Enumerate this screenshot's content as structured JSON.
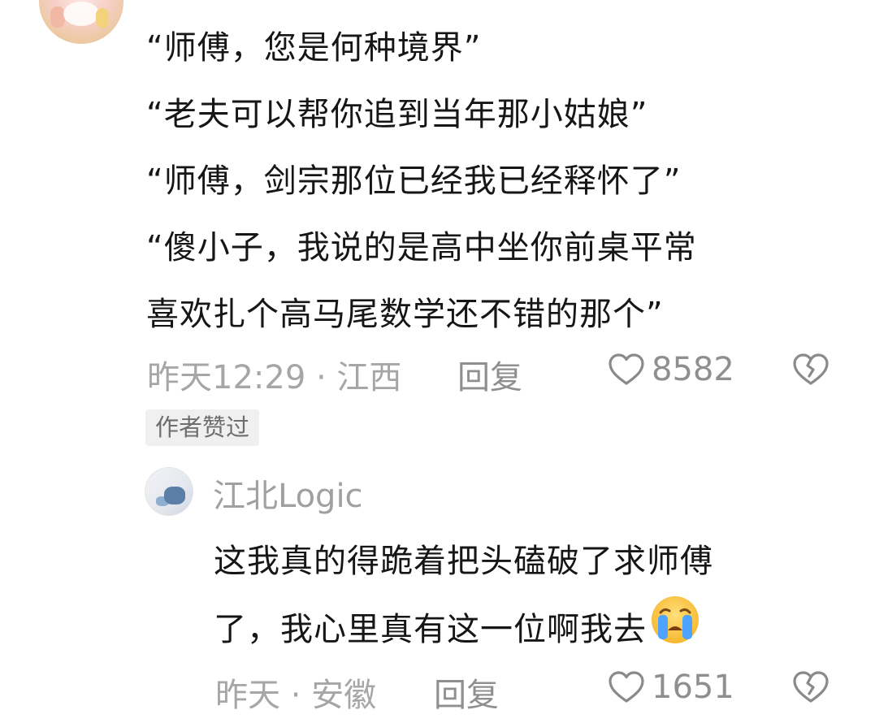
{
  "main_comment": {
    "lines": [
      "“师傅，您是何种境界”",
      "“老夫可以帮你追到当年那小姑娘”",
      "“师傅，剑宗那位已经我已经释怀了”",
      "“傻小子，我说的是高中坐你前桌平常",
      "喜欢扎个高马尾数学还不错的那个”"
    ],
    "meta": "昨天12:29 · 江西",
    "reply_label": "回复",
    "like_count": "8582",
    "author_badge": "作者赞过"
  },
  "reply_comment": {
    "username": "江北Logic",
    "lines": [
      "这我真的得跪着把头磕破了求师傅",
      "了，我心里真有这一位啊我去"
    ],
    "emoji": "crying-face",
    "meta": "昨天 · 安徽",
    "reply_label": "回复",
    "like_count": "1651"
  },
  "icons": {
    "like": "heart-outline-icon",
    "dislike": "broken-heart-icon"
  },
  "colors": {
    "text": "#161616",
    "meta": "#a6a6a6",
    "badge_bg": "#f0f0f0"
  }
}
